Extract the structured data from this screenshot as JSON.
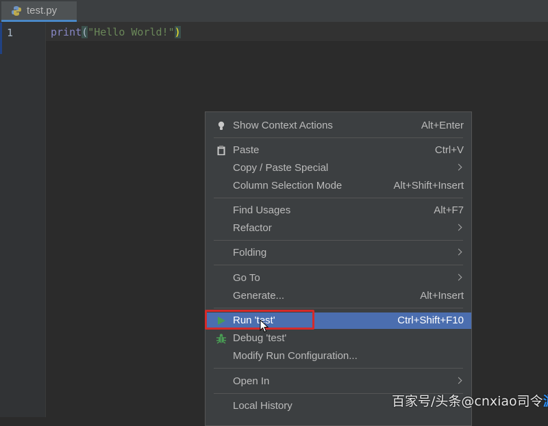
{
  "tab": {
    "filename": "test.py",
    "icon": "python-file-icon"
  },
  "editor": {
    "line_number": "1",
    "code": {
      "fn": "print",
      "open": "(",
      "string": "\"Hello World!\"",
      "close": ")"
    }
  },
  "menu": {
    "items": [
      {
        "label": "Show Context Actions",
        "shortcut": "Alt+Enter",
        "icon": "lightbulb-icon"
      },
      {
        "label": "Paste",
        "shortcut": "Ctrl+V",
        "icon": "clipboard-icon"
      },
      {
        "label": "Copy / Paste Special",
        "shortcut": "",
        "submenu": true
      },
      {
        "label": "Column Selection Mode",
        "shortcut": "Alt+Shift+Insert"
      },
      {
        "label": "Find Usages",
        "shortcut": "Alt+F7"
      },
      {
        "label": "Refactor",
        "shortcut": "",
        "submenu": true
      },
      {
        "label": "Folding",
        "shortcut": "",
        "submenu": true
      },
      {
        "label": "Go To",
        "shortcut": "",
        "submenu": true
      },
      {
        "label": "Generate...",
        "shortcut": "Alt+Insert"
      },
      {
        "label": "Run 'test'",
        "shortcut": "Ctrl+Shift+F10",
        "icon": "run-icon",
        "selected": true
      },
      {
        "label": "Debug 'test'",
        "shortcut": "",
        "icon": "debug-icon"
      },
      {
        "label": "Modify Run Configuration...",
        "shortcut": ""
      },
      {
        "label": "Open In",
        "shortcut": "",
        "submenu": true
      },
      {
        "label": "Local History",
        "shortcut": ""
      }
    ]
  },
  "colors": {
    "selection": "#4b6eaf",
    "highlight_box": "#d42a2a",
    "run_green": "#499c54"
  },
  "watermark": {
    "text": "百家号/头条@cnxiao司令",
    "logo": "游戏"
  }
}
